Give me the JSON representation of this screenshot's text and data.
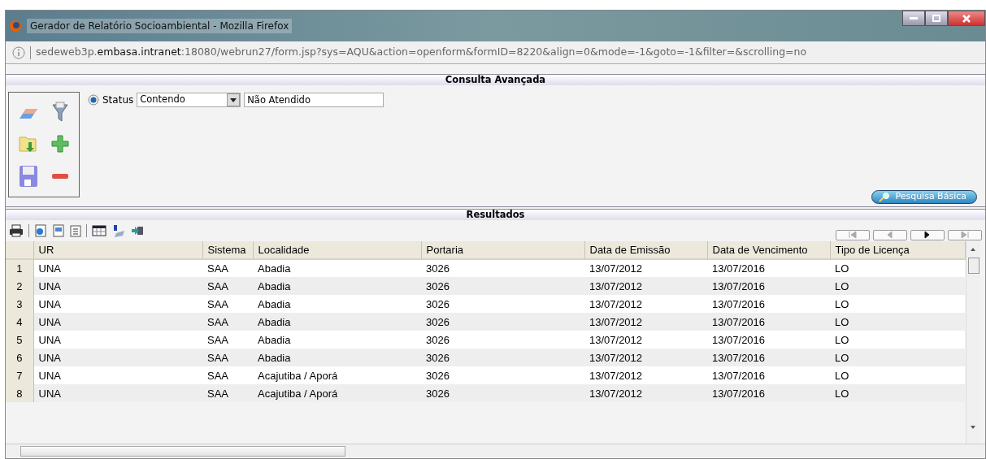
{
  "window": {
    "title": "Gerador de Relatório Socioambiental - Mozilla Firefox"
  },
  "address_bar": {
    "url": "sedeweb3p.**embasa.intranet**:18080/webrun27/form.jsp?sys=AQU&action=openform&formID=8220&align=0&mode=-1&goto=-1&filter=&scrolling=no"
  },
  "advanced_search": {
    "title": "Consulta Avançada",
    "filter": {
      "selected": true,
      "label": "Status",
      "operator": "Contendo",
      "value": "Não Atendido"
    },
    "basic_search_button": "Pesquisa Básica"
  },
  "results": {
    "title": "Resultados",
    "pager": [
      {
        "kind": "first",
        "disabled": true
      },
      {
        "kind": "prev",
        "disabled": true
      },
      {
        "kind": "next",
        "disabled": false
      },
      {
        "kind": "last",
        "disabled": true
      }
    ],
    "columns": [
      "UR",
      "Sistema",
      "Localidade",
      "Portaria",
      "Data de Emissão",
      "Data de Vencimento",
      "Tipo de Licença"
    ],
    "rows": [
      {
        "number": "1",
        "cells": [
          "UNA",
          "SAA",
          "Abadia",
          "3026",
          "13/07/2012",
          "13/07/2016",
          "LO"
        ]
      },
      {
        "number": "2",
        "cells": [
          "UNA",
          "SAA",
          "Abadia",
          "3026",
          "13/07/2012",
          "13/07/2016",
          "LO"
        ]
      },
      {
        "number": "3",
        "cells": [
          "UNA",
          "SAA",
          "Abadia",
          "3026",
          "13/07/2012",
          "13/07/2016",
          "LO"
        ]
      },
      {
        "number": "4",
        "cells": [
          "UNA",
          "SAA",
          "Abadia",
          "3026",
          "13/07/2012",
          "13/07/2016",
          "LO"
        ]
      },
      {
        "number": "5",
        "cells": [
          "UNA",
          "SAA",
          "Abadia",
          "3026",
          "13/07/2012",
          "13/07/2016",
          "LO"
        ]
      },
      {
        "number": "6",
        "cells": [
          "UNA",
          "SAA",
          "Abadia",
          "3026",
          "13/07/2012",
          "13/07/2016",
          "LO"
        ]
      },
      {
        "number": "7",
        "cells": [
          "UNA",
          "SAA",
          "Acajutiba / Aporá",
          "3026",
          "13/07/2012",
          "13/07/2016",
          "LO"
        ]
      },
      {
        "number": "8",
        "cells": [
          "UNA",
          "SAA",
          "Acajutiba / Aporá",
          "3026",
          "13/07/2012",
          "13/07/2016",
          "LO"
        ]
      }
    ]
  }
}
